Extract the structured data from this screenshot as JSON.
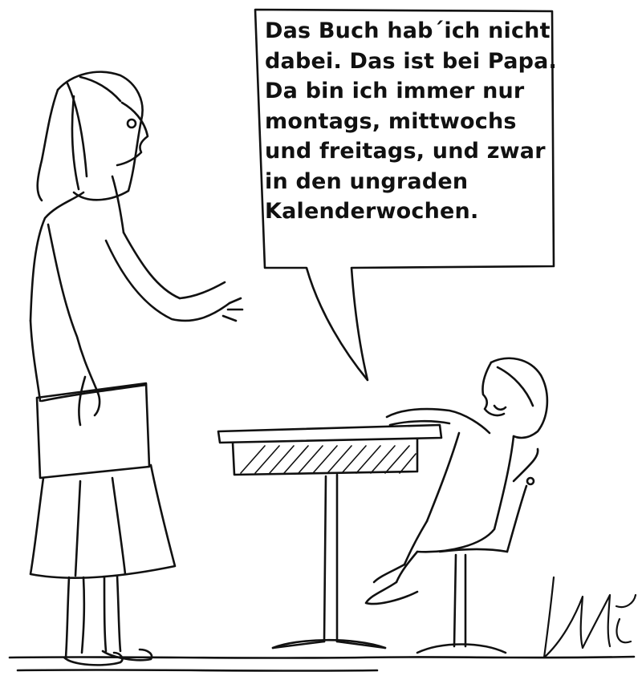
{
  "cartoon": {
    "speech_lines": [
      "Das Buch hab´ich nicht",
      "dabei. Das ist bei Papa.",
      "Da bin ich immer nur",
      "montags, mittwochs",
      "und freitags, und zwar",
      "in den ungraden",
      "Kalenderwochen."
    ],
    "signature": "Mitts",
    "ink_color": "#111111",
    "paper_color": "#ffffff"
  }
}
